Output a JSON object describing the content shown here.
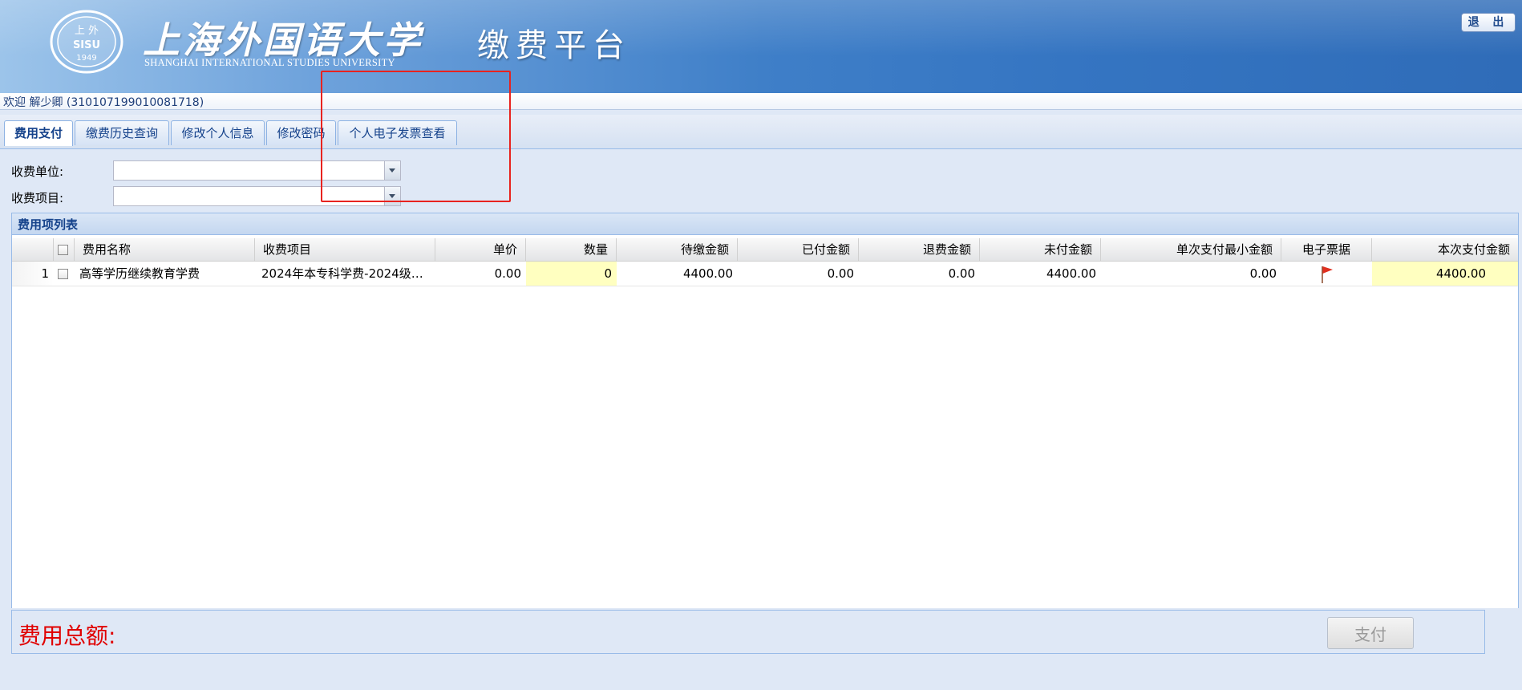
{
  "header": {
    "school_cn": "上海外国语大学",
    "school_en": "SHANGHAI INTERNATIONAL STUDIES UNIVERSITY",
    "seal_year": "1949",
    "platform": "缴费平台",
    "logout_label": "退 出"
  },
  "welcome": "欢迎 解少卿 (310107199010081718)",
  "tabs": [
    {
      "label": "费用支付",
      "active": true
    },
    {
      "label": "缴费历史查询"
    },
    {
      "label": "修改个人信息"
    },
    {
      "label": "修改密码"
    },
    {
      "label": "个人电子发票查看"
    }
  ],
  "form": {
    "unit_label": "收费单位:",
    "unit_value": "",
    "item_label": "收费项目:",
    "item_value": ""
  },
  "grid": {
    "title": "费用项列表",
    "columns": [
      "费用名称",
      "收费项目",
      "单价",
      "数量",
      "待缴金额",
      "已付金额",
      "退费金额",
      "未付金额",
      "单次支付最小金额",
      "电子票据",
      "本次支付金额"
    ],
    "rows": [
      {
        "index": "1",
        "name": "高等学历继续教育学费",
        "item": "2024年本专科学费-2024级…",
        "price": "0.00",
        "quantity": "0",
        "due": "4400.00",
        "paid": "0.00",
        "refund": "0.00",
        "unpaid": "4400.00",
        "min_pay": "0.00",
        "receipt_icon": "red-flag-icon",
        "this_pay": "4400.00"
      }
    ]
  },
  "summary": {
    "total_label": "费用总额:",
    "pay_button": "支付"
  },
  "colors": {
    "highlight": "#ffffc0",
    "total_text": "#e00000",
    "annotation_box": "#e8231f"
  }
}
